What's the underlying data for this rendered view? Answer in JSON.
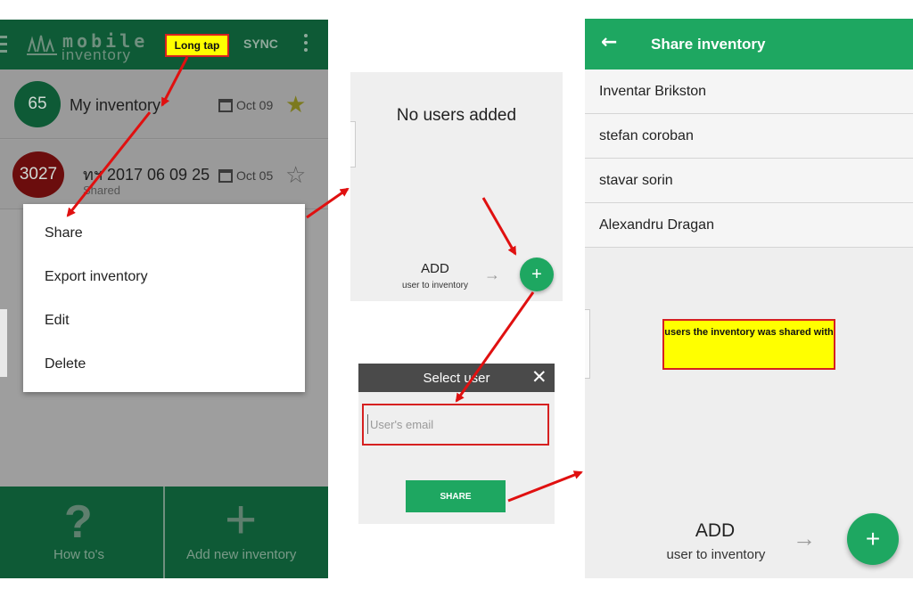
{
  "colors": {
    "accent_green": "#1ea761",
    "dark_green": "#0e5a36",
    "annotation_yellow": "#ffff00",
    "annotation_red": "#d62020"
  },
  "home": {
    "logo_top": "mobile",
    "logo_bottom": "inventory",
    "sync_label": "SYNC",
    "menu_icon": "hamburger-icon",
    "more_icon": "more-vert-icon",
    "inventories": [
      {
        "count": "65",
        "name": "My inventory",
        "subtitle": "",
        "date": "Oct 09",
        "starred": true
      },
      {
        "count": "3027",
        "name": "ทฯ 2017 06 09 25",
        "subtitle": "Shared",
        "date": "Oct 05",
        "starred": false
      }
    ],
    "context_menu": [
      "Share",
      "Export inventory",
      "Edit",
      "Delete"
    ],
    "bottom_bar": {
      "help_label": "How to's",
      "add_label": "Add new inventory"
    }
  },
  "annotations": {
    "long_tap": "Long tap",
    "shared_note": "users the inventory was shared with"
  },
  "empty_share": {
    "title": "No users added",
    "add_label": "ADD",
    "add_sub": "user to inventory",
    "fab": "+"
  },
  "select_user": {
    "title": "Select user",
    "email_placeholder": "User's email",
    "share_button": "SHARE"
  },
  "share_inventory": {
    "title": "Share inventory",
    "users": [
      "Inventar Brikston",
      "stefan coroban",
      "stavar sorin",
      "Alexandru Dragan"
    ],
    "add_label": "ADD",
    "add_sub": "user to inventory",
    "fab": "+"
  }
}
